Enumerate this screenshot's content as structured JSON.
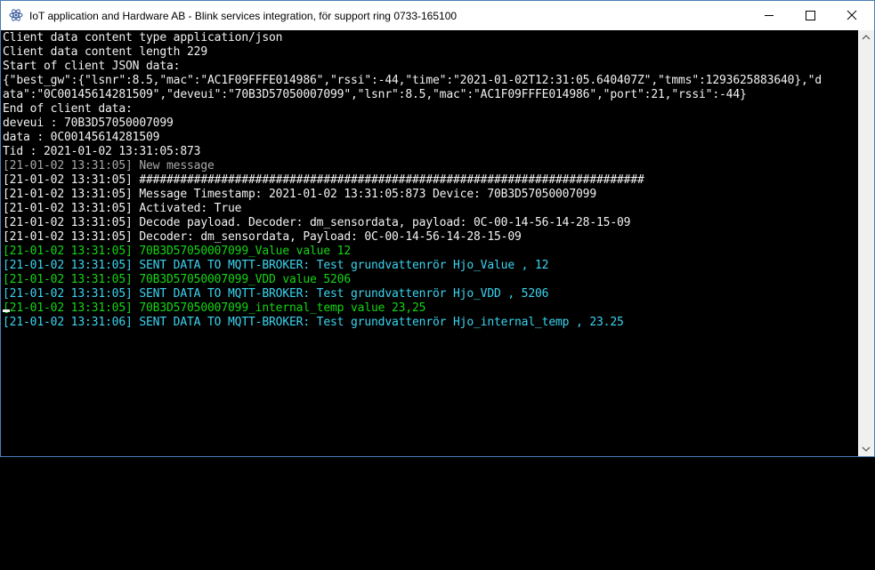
{
  "window": {
    "title": "IoT application and Hardware AB - Blink services integration, för support ring 0733-165100",
    "app_icon": "atom-icon",
    "controls": {
      "minimize_icon": "minimize-icon",
      "maximize_icon": "maximize-icon",
      "close_icon": "close-icon"
    }
  },
  "colors": {
    "white": "#f2f2f2",
    "gray": "#a8a8a8",
    "green": "#13d613",
    "cyan": "#3ad5f0",
    "background": "#000000"
  },
  "console": {
    "lines": [
      {
        "text": "Client data content type application/json",
        "color": "white"
      },
      {
        "text": "Client data content length 229",
        "color": "white"
      },
      {
        "text": "Start of client JSON data:",
        "color": "white"
      },
      {
        "text": "{\"best_gw\":{\"lsnr\":8.5,\"mac\":\"AC1F09FFFE014986\",\"rssi\":-44,\"time\":\"2021-01-02T12:31:05.640407Z\",\"tmms\":1293625883640},\"d",
        "color": "white"
      },
      {
        "text": "ata\":\"0C00145614281509\",\"deveui\":\"70B3D57050007099\",\"lsnr\":8.5,\"mac\":\"AC1F09FFFE014986\",\"port\":21,\"rssi\":-44}",
        "color": "white"
      },
      {
        "text": "End of client data:",
        "color": "white"
      },
      {
        "text": "deveui : 70B3D57050007099",
        "color": "white"
      },
      {
        "text": "data : 0C00145614281509",
        "color": "white"
      },
      {
        "text": "Tid : 2021-01-02 13:31:05:873",
        "color": "white"
      },
      {
        "text": "[21-01-02 13:31:05] New message",
        "color": "gray"
      },
      {
        "text": "[21-01-02 13:31:05] ##########################################################################",
        "color": "white"
      },
      {
        "text": "[21-01-02 13:31:05] Message Timestamp: 2021-01-02 13:31:05:873 Device: 70B3D57050007099",
        "color": "white"
      },
      {
        "text": "[21-01-02 13:31:05] Activated: True",
        "color": "white"
      },
      {
        "text": "[21-01-02 13:31:05] Decode payload. Decoder: dm_sensordata, payload: 0C-00-14-56-14-28-15-09",
        "color": "white"
      },
      {
        "text": "[21-01-02 13:31:05] Decoder: dm_sensordata, Payload: 0C-00-14-56-14-28-15-09",
        "color": "white"
      },
      {
        "text": "[21-01-02 13:31:05] 70B3D57050007099_Value value 12",
        "color": "green"
      },
      {
        "text": "[21-01-02 13:31:05] SENT DATA TO MQTT-BROKER: Test grundvattenrör Hjo_Value , 12",
        "color": "cyan"
      },
      {
        "text": "[21-01-02 13:31:05] 70B3D57050007099_VDD value 5206",
        "color": "green"
      },
      {
        "text": "[21-01-02 13:31:05] SENT DATA TO MQTT-BROKER: Test grundvattenrör Hjo_VDD , 5206",
        "color": "cyan"
      },
      {
        "text": "[21-01-02 13:31:05] 70B3D57050007099_internal_temp value 23,25",
        "color": "green"
      },
      {
        "text": "[21-01-02 13:31:06] SENT DATA TO MQTT-BROKER: Test grundvattenrör Hjo_internal_temp , 23.25",
        "color": "cyan"
      }
    ]
  },
  "scrollbar": {
    "up_icon": "scroll-up-arrow-icon",
    "down_icon": "scroll-down-arrow-icon"
  }
}
